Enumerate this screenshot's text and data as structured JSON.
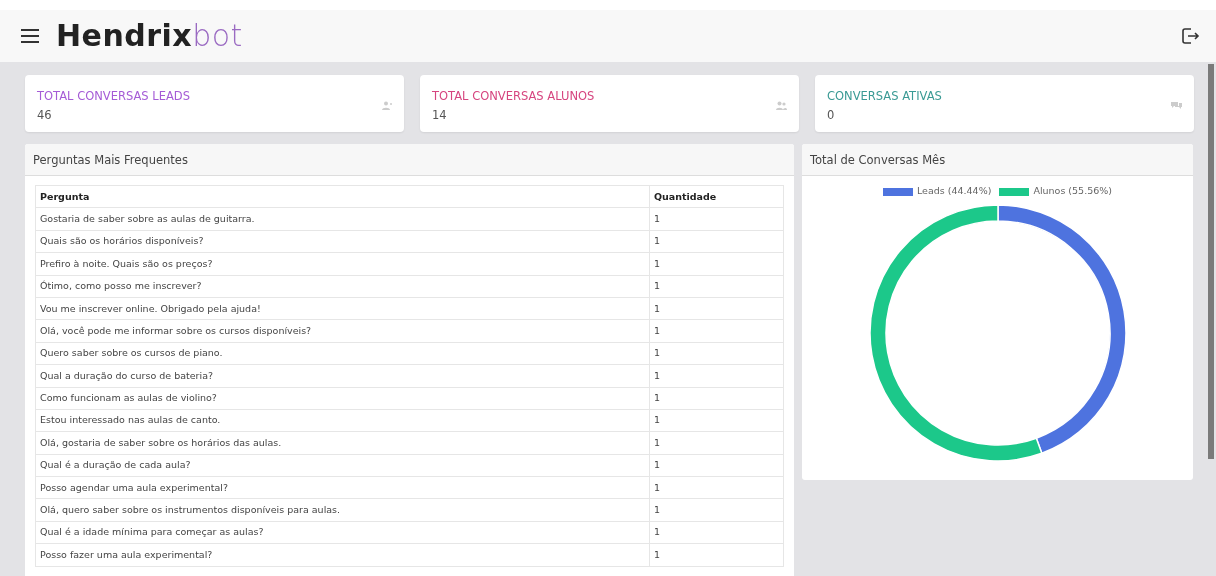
{
  "navbar": {
    "logo_bold": "Hendrix",
    "logo_light": "bot"
  },
  "stats": [
    {
      "title": "TOTAL CONVERSAS LEADS",
      "value": "46",
      "color": "#a55bd6",
      "kind": "user-plus"
    },
    {
      "title": "TOTAL CONVERSAS ALUNOS",
      "value": "14",
      "color": "#d6457f",
      "kind": "users"
    },
    {
      "title": "CONVERSAS ATIVAS",
      "value": "0",
      "color": "#3a9a94",
      "kind": "comments"
    }
  ],
  "questions_panel": {
    "title": "Perguntas Mais Frequentes",
    "columns": [
      "Pergunta",
      "Quantidade"
    ],
    "rows": [
      [
        "Gostaria de saber sobre as aulas de guitarra.",
        "1"
      ],
      [
        "Quais são os horários disponíveis?",
        "1"
      ],
      [
        "Prefiro à noite. Quais são os preços?",
        "1"
      ],
      [
        "Ótimo, como posso me inscrever?",
        "1"
      ],
      [
        "Vou me inscrever online. Obrigado pela ajuda!",
        "1"
      ],
      [
        "Olá, você pode me informar sobre os cursos disponíveis?",
        "1"
      ],
      [
        "Quero saber sobre os cursos de piano.",
        "1"
      ],
      [
        "Qual a duração do curso de bateria?",
        "1"
      ],
      [
        "Como funcionam as aulas de violino?",
        "1"
      ],
      [
        "Estou interessado nas aulas de canto.",
        "1"
      ],
      [
        "Olá, gostaria de saber sobre os horários das aulas.",
        "1"
      ],
      [
        "Qual é a duração de cada aula?",
        "1"
      ],
      [
        "Posso agendar uma aula experimental?",
        "1"
      ],
      [
        "Olá, quero saber sobre os instrumentos disponíveis para aulas.",
        "1"
      ],
      [
        "Qual é a idade mínima para começar as aulas?",
        "1"
      ],
      [
        "Posso fazer uma aula experimental?",
        "1"
      ]
    ]
  },
  "chart_panel": {
    "title": "Total de Conversas Mês",
    "chart_data": {
      "type": "donut",
      "categories": [
        "Leads (44.44%)",
        "Alunos (55.56%)"
      ],
      "values": [
        44.44,
        55.56
      ],
      "legend": "top",
      "colors": [
        "#4e73df",
        "#1cc88a"
      ]
    }
  }
}
